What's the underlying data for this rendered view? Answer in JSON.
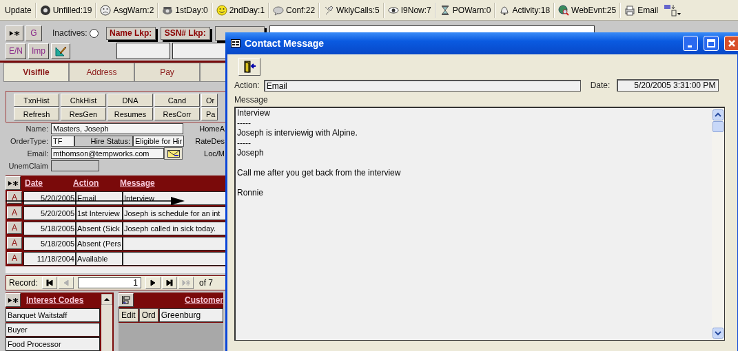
{
  "toolbar": {
    "update": "Update",
    "items": [
      "Unfilled:19",
      "AsgWarn:2",
      "1stDay:0",
      "2ndDay:1",
      "Conf:22",
      "WklyCalls:5",
      "I9Now:7",
      "POWarn:0",
      "Activity:18",
      "WebEvnt:25",
      "Email"
    ]
  },
  "controls": {
    "top_buttons": [
      "G"
    ],
    "bottom_buttons": [
      "E/N",
      "Imp"
    ],
    "inactives": {
      "label": "Inactives:",
      "checked": false
    },
    "lookups": [
      "Name Lkp:",
      "SSN# Lkp:"
    ]
  },
  "tabs": [
    {
      "label": "Visifile",
      "selected": true
    },
    {
      "label": "Address",
      "selected": false
    },
    {
      "label": "Pay",
      "selected": false
    }
  ],
  "action_buttons": [
    [
      "TxnHist",
      "ChkHist",
      "DNA",
      "Cand",
      "Or"
    ],
    [
      "Refresh",
      "ResGen",
      "Resumes",
      "ResCorr",
      "Pa"
    ]
  ],
  "candidate": {
    "name_label": "Name:",
    "name": "Masters, Joseph",
    "order_type_label": "OrderType:",
    "order_type": "TF",
    "hire_status_label": "Hire Status:",
    "hire_status": "Eligible for Hir",
    "email_label": "Email:",
    "email": "mthomson@tempworks.com",
    "unem_claim_label": "UnemClaim",
    "right_labels": [
      "HomeA",
      "RateDes",
      "Loc/M"
    ]
  },
  "contacts": {
    "columns": [
      "Date",
      "Action",
      "Message"
    ],
    "rows": [
      {
        "selector": "A",
        "date": "5/20/2005",
        "action": "Email",
        "message": "Interview"
      },
      {
        "selector": "A",
        "date": "5/20/2005",
        "action": "1st Interview",
        "message": "Joseph is schedule for an int"
      },
      {
        "selector": "A",
        "date": "5/18/2005",
        "action": "Absent (Sick",
        "message": "Joseph called in sick today."
      },
      {
        "selector": "A",
        "date": "5/18/2005",
        "action": "Absent (Pers"
      },
      {
        "selector": "A",
        "date": "11/18/2004",
        "action": "Available"
      }
    ]
  },
  "record_nav": {
    "label": "Record:",
    "current": "1",
    "total": "of 7",
    "buttons": [
      {
        "kind": "first",
        "disabled": false
      },
      {
        "kind": "prev",
        "disabled": true
      },
      {
        "kind": "next",
        "disabled": false
      },
      {
        "kind": "last",
        "disabled": false
      },
      {
        "kind": "new",
        "disabled": true
      }
    ]
  },
  "interest_codes": {
    "heading": "Interest Codes",
    "items": [
      "Banquet Waitstaff",
      "Buyer",
      "Food Processor"
    ]
  },
  "customers": {
    "heading": "Customer",
    "rows": [
      {
        "edit": "Edit",
        "ord": "Ord",
        "name": "Greenburg"
      }
    ]
  },
  "dialog": {
    "title": "Contact Message",
    "action_label": "Action:",
    "action": "Email",
    "date_label": "Date:",
    "date": "5/20/2005 3:31:00 PM",
    "message_label": "Message",
    "message": "Interview\n-----\nJoseph is interviewig with Alpine.\n-----\nJoseph\n\nCall me after you get back from the interview\n\nRonnie"
  }
}
